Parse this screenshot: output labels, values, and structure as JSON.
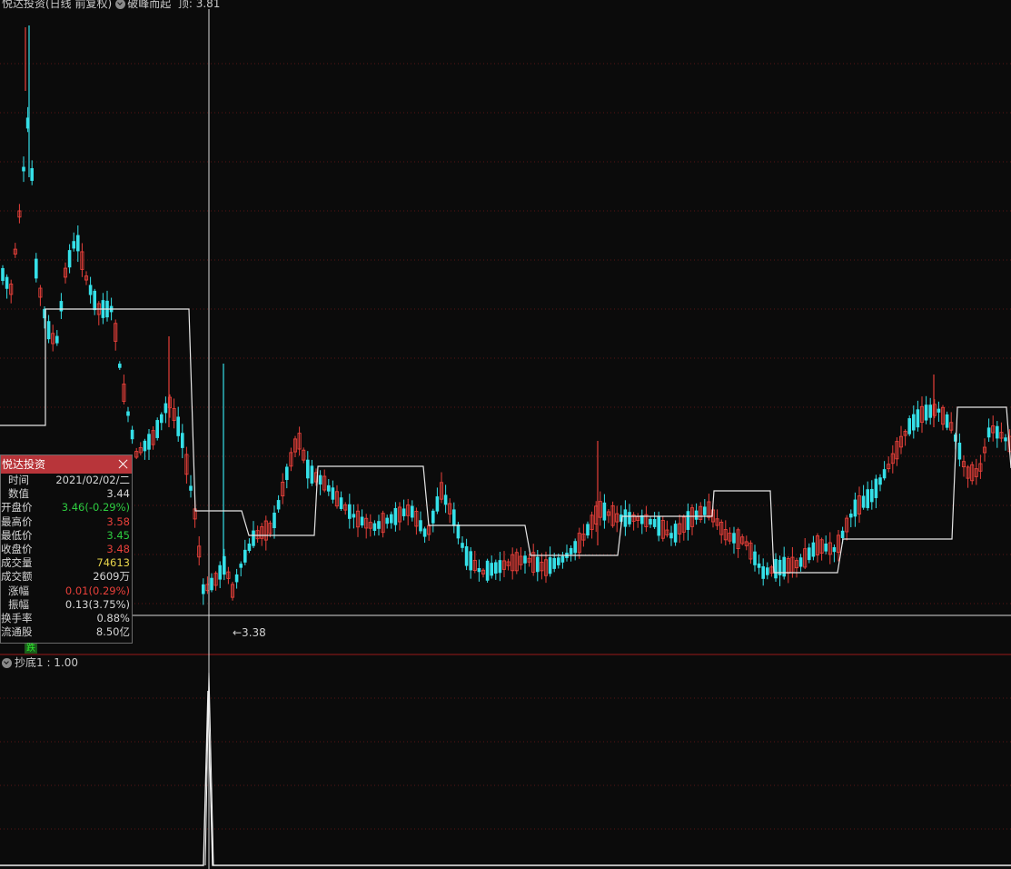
{
  "header": {
    "title": "悦达投资(日线 前复权)",
    "indicator": "破峰而起",
    "value_label": "顶: 3.81"
  },
  "sub_header": {
    "label": "抄底1 : 1.00"
  },
  "price_marker": "←3.38",
  "down_badge": "跌",
  "info_panel": {
    "title": "悦达投资",
    "rows": [
      {
        "k": "时间",
        "v": "2021/02/02/二",
        "color": "#d6d6d6"
      },
      {
        "k": "数值",
        "v": "3.44",
        "color": "#d6d6d6"
      },
      {
        "k": "开盘价",
        "v": "3.46(-0.29%)",
        "color": "#2ecc40"
      },
      {
        "k": "最高价",
        "v": "3.58",
        "color": "#e8403a"
      },
      {
        "k": "最低价",
        "v": "3.45",
        "color": "#2ecc40"
      },
      {
        "k": "收盘价",
        "v": "3.48",
        "color": "#e8403a"
      },
      {
        "k": "成交量",
        "v": "74613",
        "color": "#e6d34a"
      },
      {
        "k": "成交额",
        "v": "2609万",
        "color": "#d6d6d6"
      },
      {
        "k": "涨幅",
        "v": "0.01(0.29%)",
        "color": "#e8403a"
      },
      {
        "k": "振幅",
        "v": "0.13(3.75%)",
        "color": "#d6d6d6"
      },
      {
        "k": "换手率",
        "v": "0.88%",
        "color": "#d6d6d6"
      },
      {
        "k": "流通股",
        "v": "8.50亿",
        "color": "#d6d6d6"
      }
    ]
  },
  "colors": {
    "up": "#e8403a",
    "down": "#35e0e8",
    "step_line": "#e6e6e6",
    "grid": "#5a1515"
  }
}
